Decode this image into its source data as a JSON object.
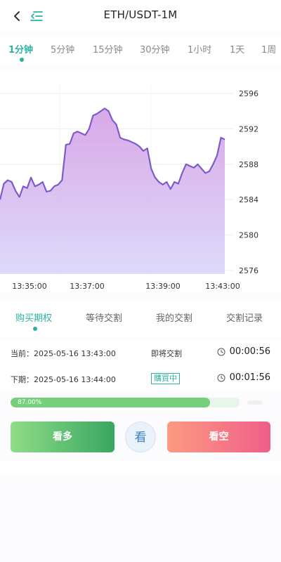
{
  "header": {
    "title": "ETH/USDT-1M"
  },
  "period_tabs": [
    "1分钟",
    "5分钟",
    "15分钟",
    "30分钟",
    "1小时",
    "1天",
    "1周"
  ],
  "chart_data": {
    "type": "area",
    "y_ticks": [
      "2596",
      "2592",
      "2588",
      "2584",
      "2580",
      "2576"
    ],
    "x_ticks": [
      "13:35:00",
      "13:37:00",
      "13:39:00",
      "13:43:00"
    ],
    "ylim": [
      2576,
      2596
    ],
    "series": [
      {
        "values": [
          2584,
          2585.8,
          2586.2,
          2586.0,
          2585.0,
          2584.3,
          2585.5,
          2585.3,
          2586.5,
          2585.5,
          2585.7,
          2586.0,
          2584.9,
          2585.0,
          2585.5,
          2585.7,
          2586.2,
          2590.2,
          2590.3,
          2591.5,
          2591.7,
          2591.5,
          2591.3,
          2592.0,
          2593.5,
          2593.7,
          2594.0,
          2594.3,
          2594.0,
          2593.0,
          2592.5,
          2591.0,
          2590.8,
          2590.7,
          2590.5,
          2590.3,
          2590.0,
          2589.5,
          2589.8,
          2587.5,
          2586.5,
          2586.0,
          2585.7,
          2586.0,
          2585.2,
          2586.0,
          2585.8,
          2587.0,
          2588.0,
          2587.8,
          2587.6,
          2588.0,
          2587.5,
          2587.0,
          2587.2,
          2588.0,
          2589.0,
          2591.0,
          2590.8
        ]
      }
    ]
  },
  "order_tabs": [
    "购买期权",
    "等待交割",
    "我的交割",
    "交割记录"
  ],
  "rows": [
    {
      "label": "当前：2025-05-16 13:43:00",
      "status": "即将交割",
      "timer": "00:00:56"
    },
    {
      "label": "下期：2025-05-16 13:44:00",
      "status": "購買中",
      "timer": "00:01:56"
    }
  ],
  "progress": {
    "percent": 87,
    "label": "87.00%"
  },
  "buttons": {
    "up": "看多",
    "view": "看",
    "down": "看空"
  },
  "colors": {
    "accent": "#2ab29f",
    "line": "#7c5ccc",
    "up": "#39a661",
    "down": "#ef5e8a"
  }
}
